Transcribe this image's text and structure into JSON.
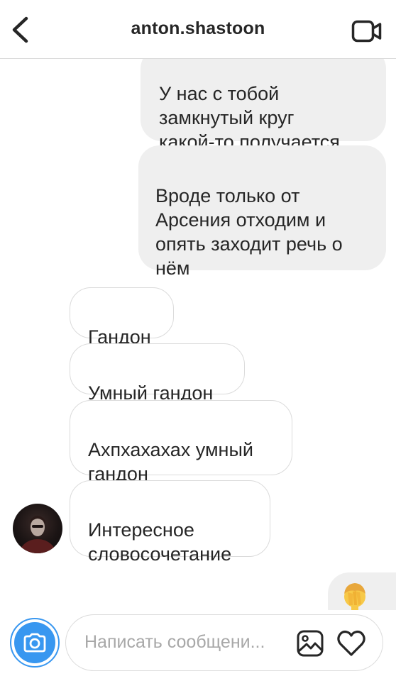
{
  "header": {
    "title": "anton.shastoon",
    "back_icon": "chevron-left-icon",
    "video_icon": "video-camera-icon"
  },
  "messages": [
    {
      "direction": "out",
      "text": "У нас с тобой\nзамкнутый круг\nкакой-то получается"
    },
    {
      "direction": "out",
      "text": "Вроде только от\nАрсения отходим и\nопять заходит речь о\nнём"
    },
    {
      "direction": "in",
      "text": "Гандон"
    },
    {
      "direction": "in",
      "text": "Умный гандон"
    },
    {
      "direction": "in",
      "text": "Ахпхахахах умный\nгандон"
    },
    {
      "direction": "in",
      "text": "Интересное\nсловосочетание"
    },
    {
      "direction": "out",
      "emoji": "face-palm-emoji"
    }
  ],
  "composer": {
    "placeholder": "Написать сообщени...",
    "camera_icon": "camera-icon",
    "gallery_icon": "gallery-icon",
    "like_icon": "heart-icon"
  },
  "colors": {
    "accent": "#3897f0",
    "outgoing_bubble": "#efefef",
    "incoming_border": "#dbdbdb",
    "text": "#262626",
    "placeholder": "#a8a8a8"
  }
}
